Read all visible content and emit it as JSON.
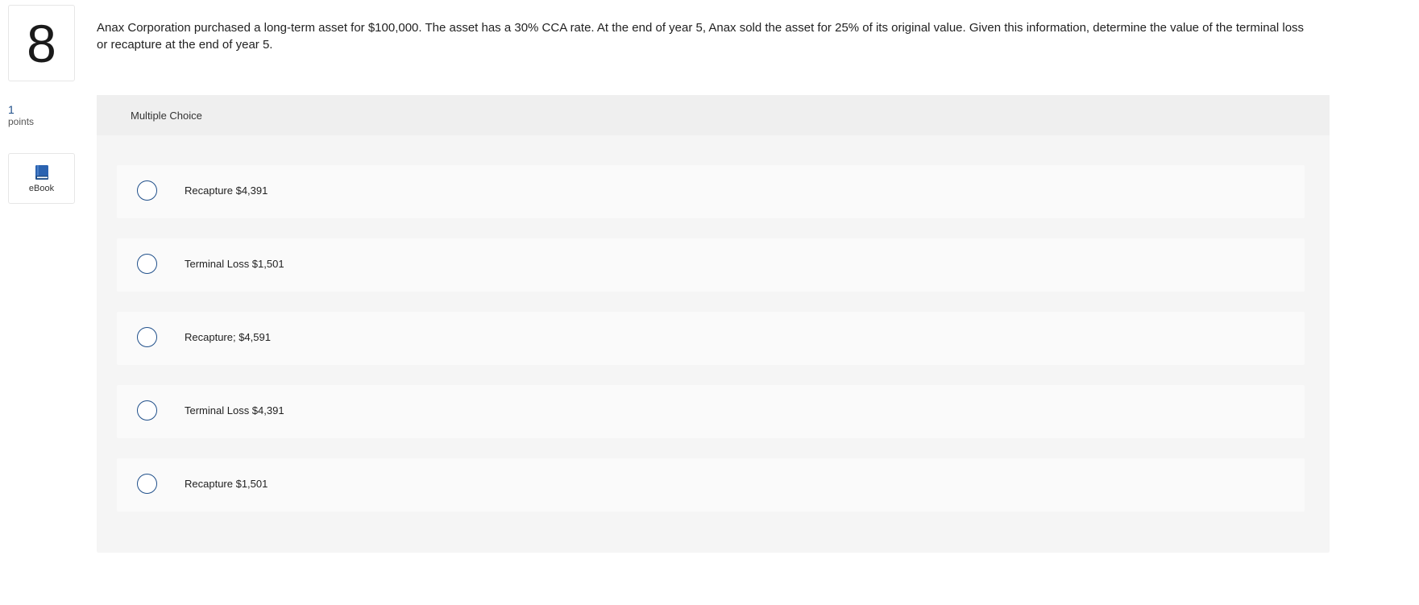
{
  "question": {
    "number": "8",
    "points_value": "1",
    "points_label": "points",
    "ebook_label": "eBook",
    "ebook_icon": "book-icon",
    "text": "Anax Corporation purchased a long-term asset for $100,000. The asset has a 30% CCA rate. At the end of year 5, Anax sold the asset for 25% of its original value. Given this information, determine the value of the terminal loss or recapture at the end of year 5."
  },
  "multiple_choice": {
    "header": "Multiple Choice",
    "options": [
      {
        "label": "Recapture $4,391"
      },
      {
        "label": "Terminal Loss $1,501"
      },
      {
        "label": "Recapture; $4,591"
      },
      {
        "label": "Terminal Loss $4,391"
      },
      {
        "label": "Recapture $1,501"
      }
    ]
  },
  "colors": {
    "accent": "#1f4f8a",
    "panel_bg": "#f5f5f5",
    "option_bg": "#fafafa"
  }
}
